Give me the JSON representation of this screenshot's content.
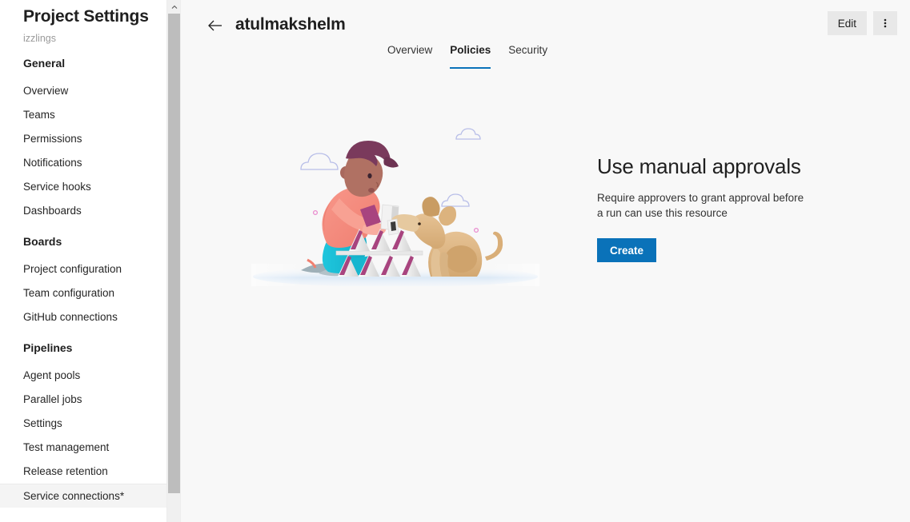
{
  "sidebar": {
    "title": "Project Settings",
    "project_name": "izzlings",
    "groups": [
      {
        "header": "General",
        "items": [
          {
            "label": "Overview",
            "selected": false
          },
          {
            "label": "Teams",
            "selected": false
          },
          {
            "label": "Permissions",
            "selected": false
          },
          {
            "label": "Notifications",
            "selected": false
          },
          {
            "label": "Service hooks",
            "selected": false
          },
          {
            "label": "Dashboards",
            "selected": false
          }
        ]
      },
      {
        "header": "Boards",
        "items": [
          {
            "label": "Project configuration",
            "selected": false
          },
          {
            "label": "Team configuration",
            "selected": false
          },
          {
            "label": "GitHub connections",
            "selected": false
          }
        ]
      },
      {
        "header": "Pipelines",
        "items": [
          {
            "label": "Agent pools",
            "selected": false
          },
          {
            "label": "Parallel jobs",
            "selected": false
          },
          {
            "label": "Settings",
            "selected": false
          },
          {
            "label": "Test management",
            "selected": false
          },
          {
            "label": "Release retention",
            "selected": false
          },
          {
            "label": "Service connections*",
            "selected": true
          }
        ]
      }
    ],
    "scrollbar": {
      "up_arrow_icon": "chevron-up-icon",
      "thumb_color": "#bdbdbd"
    }
  },
  "header": {
    "back_icon": "arrow-left-icon",
    "title": "atulmakshelm",
    "edit_label": "Edit",
    "more_icon": "more-vertical-icon"
  },
  "tabs": [
    {
      "label": "Overview",
      "active": false
    },
    {
      "label": "Policies",
      "active": true
    },
    {
      "label": "Security",
      "active": false
    }
  ],
  "zero_data": {
    "illustration_name": "person-building-card-house-with-dog-illustration",
    "title": "Use manual approvals",
    "description": "Require approvers to grant approval before a run can use this resource",
    "create_label": "Create"
  },
  "colors": {
    "accent_blue": "#0a72b9",
    "main_background": "#f8f8f8",
    "sidebar_background": "#ffffff",
    "selected_item_background": "#f4f4f4",
    "button_gray": "#e8e8e8",
    "muted_text": "#9a9a9a",
    "cloud_outline": "#b8bee8",
    "dot_pink": "#e98ccf",
    "shirt_coral": "#f3877a",
    "pants_teal": "#1cbcd4",
    "hair_plum": "#7a3a5c",
    "skin_brown": "#a9695e",
    "dog_tan": "#e0b880",
    "card_magenta": "#a8447f",
    "ground_blue": "#dce9f7"
  }
}
